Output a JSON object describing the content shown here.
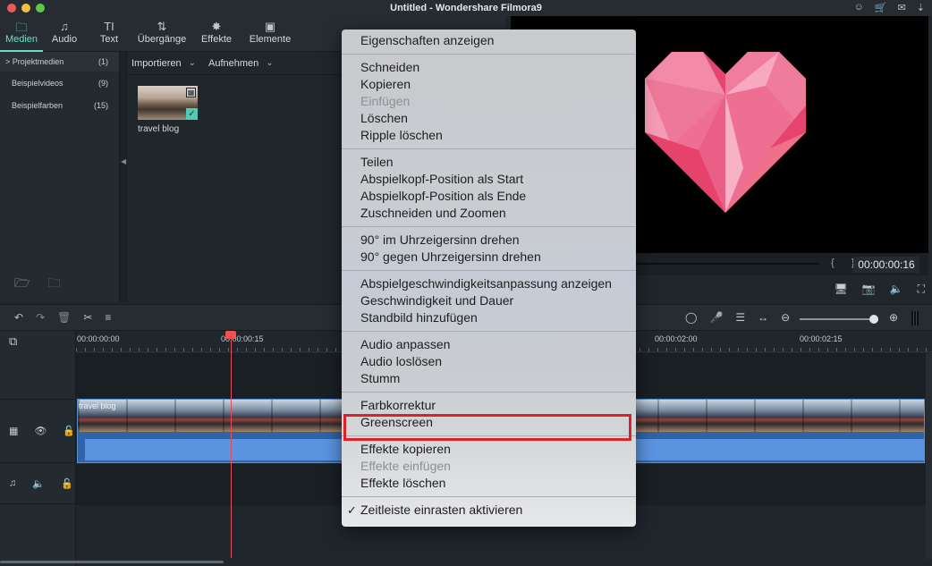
{
  "window": {
    "title": "Untitled - Wondershare Filmora9",
    "top_icons": [
      "user-icon",
      "cart-icon",
      "mail-icon",
      "download-icon"
    ]
  },
  "media_tabs": [
    {
      "label": "Medien",
      "icon": "folder-icon",
      "active": true
    },
    {
      "label": "Audio",
      "icon": "music-note-icon",
      "active": false
    },
    {
      "label": "Text",
      "icon": "text-icon",
      "active": false
    },
    {
      "label": "Übergänge",
      "icon": "transition-icon",
      "active": false
    },
    {
      "label": "Effekte",
      "icon": "effects-icon",
      "active": false
    },
    {
      "label": "Elemente",
      "icon": "image-icon",
      "active": false
    }
  ],
  "sidebar": {
    "items": [
      {
        "label": "Projektmedien",
        "count": "(1)",
        "active": true,
        "prefix": ">"
      },
      {
        "label": "Beispielvideos",
        "count": "(9)",
        "active": false
      },
      {
        "label": "Beispielfarben",
        "count": "(15)",
        "active": false
      }
    ]
  },
  "media": {
    "import_label": "Importieren",
    "record_label": "Aufnehmen",
    "items": [
      {
        "label": "travel blog",
        "selected": true
      }
    ]
  },
  "preview": {
    "timecode": "00:00:00:16",
    "braces": "{ }",
    "progress_percent": 0
  },
  "timeline": {
    "ruler": [
      "00:00:00:00",
      "00:00:00:15",
      "00:00:02:00",
      "00:00:02:15"
    ],
    "clip_label": "travel blog",
    "zoom_level_percent": 92
  },
  "context_menu": {
    "groups": [
      [
        {
          "label": "Eigenschaften anzeigen"
        }
      ],
      [
        {
          "label": "Schneiden"
        },
        {
          "label": "Kopieren"
        },
        {
          "label": "Einfügen",
          "disabled": true
        },
        {
          "label": "Löschen"
        },
        {
          "label": "Ripple löschen"
        }
      ],
      [
        {
          "label": "Teilen"
        },
        {
          "label": "Abspielkopf-Position als Start"
        },
        {
          "label": "Abspielkopf-Position als Ende"
        },
        {
          "label": "Zuschneiden und Zoomen"
        }
      ],
      [
        {
          "label": "90° im Uhrzeigersinn drehen"
        },
        {
          "label": "90° gegen Uhrzeigersinn drehen"
        }
      ],
      [
        {
          "label": "Abspielgeschwindigkeitsanpassung anzeigen"
        },
        {
          "label": "Geschwindigkeit und Dauer"
        },
        {
          "label": "Standbild hinzufügen"
        }
      ],
      [
        {
          "label": "Audio anpassen"
        },
        {
          "label": "Audio loslösen"
        },
        {
          "label": "Stumm"
        }
      ],
      [
        {
          "label": "Farbkorrektur"
        },
        {
          "label": "Greenscreen",
          "highlighted": true
        }
      ],
      [
        {
          "label": "Effekte kopieren"
        },
        {
          "label": "Effekte einfügen",
          "disabled": true
        },
        {
          "label": "Effekte löschen"
        }
      ],
      [
        {
          "label": "Zeitleiste einrasten aktivieren",
          "checked": true
        }
      ]
    ]
  },
  "colors": {
    "accent": "#6fdcc8",
    "playhead": "#f05252",
    "highlight_box": "#d9222a",
    "clip_audio": "#5a93e0"
  }
}
